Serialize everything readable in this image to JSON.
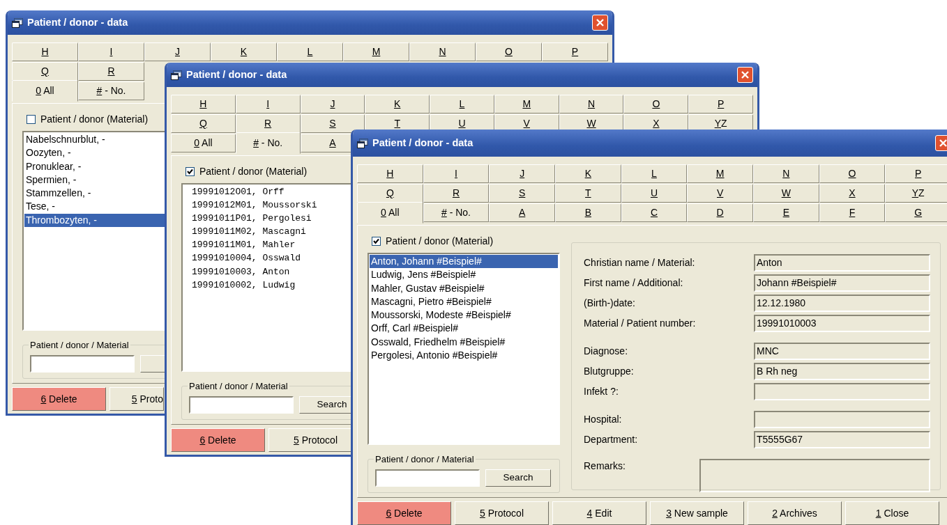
{
  "windows": [
    {
      "title": "Patient / donor - data",
      "tab_rows": [
        [
          {
            "label": "H",
            "selected": false
          },
          {
            "label": "I",
            "selected": false
          },
          {
            "label": "J",
            "selected": false
          },
          {
            "label": "K",
            "selected": false
          },
          {
            "label": "L",
            "selected": false
          },
          {
            "label": "M",
            "selected": false
          },
          {
            "label": "N",
            "selected": false
          },
          {
            "label": "O",
            "selected": false
          },
          {
            "label": "P",
            "selected": false
          }
        ],
        [
          {
            "label": "Q",
            "selected": false
          },
          {
            "label": "R",
            "selected": false
          }
        ],
        [
          {
            "label": "0 All",
            "selected": true
          },
          {
            "label": "# - No.",
            "selected": false
          }
        ]
      ],
      "filter": {
        "label": "Patient / donor (Material)",
        "checked": false
      },
      "list": {
        "kind": "names",
        "items": [
          {
            "text": "Nabelschnurblut, -",
            "selected": false
          },
          {
            "text": "Oozyten, -",
            "selected": false
          },
          {
            "text": "Pronuklear, -",
            "selected": false
          },
          {
            "text": "Spermien, -",
            "selected": false
          },
          {
            "text": "Stammzellen, -",
            "selected": false
          },
          {
            "text": "Tese, -",
            "selected": false
          },
          {
            "text": "Thrombozyten, -",
            "selected": true
          }
        ]
      },
      "search": {
        "legend": "Patient / donor / Material"
      },
      "buttons": [
        {
          "label": "6 Delete",
          "kind": "delete"
        },
        {
          "label": "5 Proto",
          "kind": "normal"
        }
      ]
    },
    {
      "title": "Patient / donor - data",
      "tab_rows": [
        [
          {
            "label": "H",
            "selected": false
          },
          {
            "label": "I",
            "selected": false
          },
          {
            "label": "J",
            "selected": false
          },
          {
            "label": "K",
            "selected": false
          },
          {
            "label": "L",
            "selected": false
          },
          {
            "label": "M",
            "selected": false
          },
          {
            "label": "N",
            "selected": false
          },
          {
            "label": "O",
            "selected": false
          },
          {
            "label": "P",
            "selected": false
          }
        ],
        [
          {
            "label": "Q",
            "selected": false
          },
          {
            "label": "R",
            "selected": false
          },
          {
            "label": "S",
            "selected": false
          },
          {
            "label": "T",
            "selected": false
          },
          {
            "label": "U",
            "selected": false
          },
          {
            "label": "V",
            "selected": false
          },
          {
            "label": "W",
            "selected": false
          },
          {
            "label": "X",
            "selected": false
          },
          {
            "label": "YZ",
            "selected": false
          }
        ],
        [
          {
            "label": "0 All",
            "selected": false
          },
          {
            "label": "# - No.",
            "selected": true
          },
          {
            "label": "A",
            "selected": false
          }
        ]
      ],
      "filter": {
        "label": "Patient / donor (Material)",
        "checked": true
      },
      "list": {
        "kind": "numbers",
        "items": [
          {
            "text": "19991012O01, Orff",
            "selected": false
          },
          {
            "text": "19991012M01, Moussorski",
            "selected": false
          },
          {
            "text": "19991011P01, Pergolesi",
            "selected": false
          },
          {
            "text": "19991011M02, Mascagni",
            "selected": false
          },
          {
            "text": "19991011M01, Mahler",
            "selected": false
          },
          {
            "text": "19991010004, Osswald",
            "selected": false
          },
          {
            "text": "19991010003, Anton",
            "selected": false
          },
          {
            "text": "19991010002, Ludwig",
            "selected": false
          }
        ]
      },
      "search": {
        "legend": "Patient / donor / Material",
        "button": "Search"
      },
      "buttons": [
        {
          "label": "6 Delete",
          "kind": "delete"
        },
        {
          "label": "5 Protocol",
          "kind": "normal"
        }
      ]
    },
    {
      "title": "Patient / donor - data",
      "tab_rows": [
        [
          {
            "label": "H",
            "selected": false
          },
          {
            "label": "I",
            "selected": false
          },
          {
            "label": "J",
            "selected": false
          },
          {
            "label": "K",
            "selected": false
          },
          {
            "label": "L",
            "selected": false
          },
          {
            "label": "M",
            "selected": false
          },
          {
            "label": "N",
            "selected": false
          },
          {
            "label": "O",
            "selected": false
          },
          {
            "label": "P",
            "selected": false
          }
        ],
        [
          {
            "label": "Q",
            "selected": false
          },
          {
            "label": "R",
            "selected": false
          },
          {
            "label": "S",
            "selected": false
          },
          {
            "label": "T",
            "selected": false
          },
          {
            "label": "U",
            "selected": false
          },
          {
            "label": "V",
            "selected": false
          },
          {
            "label": "W",
            "selected": false
          },
          {
            "label": "X",
            "selected": false
          },
          {
            "label": "YZ",
            "selected": false
          }
        ],
        [
          {
            "label": "0 All",
            "selected": true
          },
          {
            "label": "# - No.",
            "selected": false
          },
          {
            "label": "A",
            "selected": false
          },
          {
            "label": "B",
            "selected": false
          },
          {
            "label": "C",
            "selected": false
          },
          {
            "label": "D",
            "selected": false
          },
          {
            "label": "E",
            "selected": false
          },
          {
            "label": "F",
            "selected": false
          },
          {
            "label": "G",
            "selected": false
          }
        ]
      ],
      "filter": {
        "label": "Patient / donor (Material)",
        "checked": true
      },
      "list": {
        "kind": "names",
        "items": [
          {
            "text": "Anton, Johann #Beispiel#",
            "selected": true
          },
          {
            "text": "Ludwig, Jens #Beispiel#",
            "selected": false
          },
          {
            "text": "Mahler, Gustav #Beispiel#",
            "selected": false
          },
          {
            "text": "Mascagni, Pietro #Beispiel#",
            "selected": false
          },
          {
            "text": "Moussorski, Modeste #Beispiel#",
            "selected": false
          },
          {
            "text": "Orff, Carl #Beispiel#",
            "selected": false
          },
          {
            "text": "Osswald, Friedhelm #Beispiel#",
            "selected": false
          },
          {
            "text": "Pergolesi, Antonio #Beispiel#",
            "selected": false
          }
        ]
      },
      "search": {
        "legend": "Patient / donor / Material",
        "button": "Search"
      },
      "details": {
        "groups": [
          [
            {
              "label": "Christian name /  Material:",
              "value": "Anton"
            },
            {
              "label": "First name /  Additional:",
              "value": "Johann #Beispiel#"
            },
            {
              "label": "(Birth-)date:",
              "value": "12.12.1980"
            },
            {
              "label": "Material / Patient number:",
              "value": "19991010003"
            }
          ],
          [
            {
              "label": "Diagnose:",
              "value": "MNC"
            },
            {
              "label": "Blutgruppe:",
              "value": "B Rh neg"
            },
            {
              "label": "Infekt ?:"
            }
          ],
          [
            {
              "label": "Hospital:"
            },
            {
              "label": "Department:",
              "value": "T5555G67"
            }
          ]
        ],
        "remarks": {
          "label": "Remarks:"
        }
      },
      "buttons": [
        {
          "label": "6 Delete",
          "kind": "delete"
        },
        {
          "label": "5 Protocol",
          "kind": "normal"
        },
        {
          "label": "4 Edit",
          "kind": "normal"
        },
        {
          "label": "3 New sample",
          "kind": "normal"
        },
        {
          "label": "2 Archives",
          "kind": "normal"
        },
        {
          "label": "1 Close",
          "kind": "normal"
        }
      ]
    }
  ]
}
